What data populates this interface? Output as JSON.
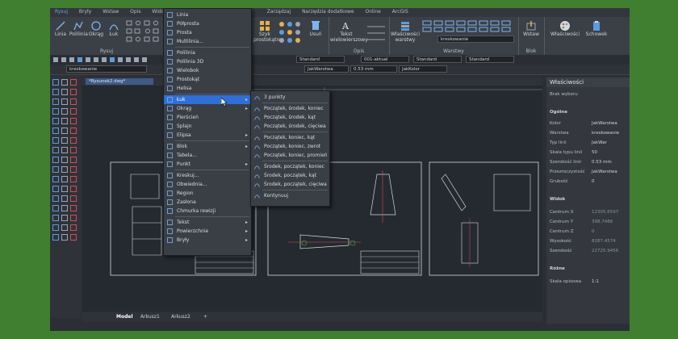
{
  "ribbon": {
    "tabs": [
      "Rysuj",
      "Bryły",
      "Wstaw",
      "Opis",
      "Widok",
      "Zarządzaj",
      "Narzędzia dodatkowe",
      "Online",
      "ArcGIS"
    ],
    "group_rysuj": "Rysuj",
    "group_opis": "Opis",
    "group_warstwy": "Warstwy",
    "group_blok": "Blok",
    "tools": {
      "linia": "Linia",
      "polilinia": "Polilinia",
      "okrag": "Okrąg",
      "luk": "Łuk",
      "szyk": "Szyk prostokątny",
      "usun": "Usuń",
      "tekst": "Tekst wielowierszowy",
      "wlasciwosci_warstwy": "Właściwości warstwy",
      "wstaw": "Wstaw",
      "wlasciwosci": "Właściwości",
      "schowek": "Schowek"
    },
    "layer_combo": "kreskowanie"
  },
  "toolbar": {
    "layer": "kreskowanie",
    "style1": "Standard",
    "style2": "001-aktual",
    "style3": "Standard",
    "style4": "Standard",
    "linetype": "JakWarstwa",
    "lineweight": "0.53 mm",
    "color": "JakKolor"
  },
  "document": {
    "tab_name": "*Rysunek2.dwg*"
  },
  "layout_tabs": [
    "Model",
    "Arkusz1",
    "Arkusz2"
  ],
  "menu_rysuj": {
    "items": [
      {
        "label": "Linia",
        "arrow": false
      },
      {
        "label": "Półprosta",
        "arrow": false
      },
      {
        "label": "Prosta",
        "arrow": false
      },
      {
        "label": "Multilinia...",
        "arrow": false
      },
      {
        "label": "Polilinia",
        "arrow": false
      },
      {
        "label": "Polilinia 3D",
        "arrow": false
      },
      {
        "label": "Wielobok",
        "arrow": false
      },
      {
        "label": "Prostokąt",
        "arrow": false
      },
      {
        "label": "Helisa",
        "arrow": false
      },
      {
        "label": "Łuk",
        "arrow": true
      },
      {
        "label": "Okrąg",
        "arrow": true
      },
      {
        "label": "Pierścień",
        "arrow": false
      },
      {
        "label": "Splajn",
        "arrow": false
      },
      {
        "label": "Elipsa",
        "arrow": true
      },
      {
        "label": "Blok",
        "arrow": true
      },
      {
        "label": "Tabela...",
        "arrow": false
      },
      {
        "label": "Punkt",
        "arrow": true
      },
      {
        "label": "Kreskuj...",
        "arrow": false
      },
      {
        "label": "Obwiednia...",
        "arrow": false
      },
      {
        "label": "Region",
        "arrow": false
      },
      {
        "label": "Zasłona",
        "arrow": false
      },
      {
        "label": "Chmurka rewizji",
        "arrow": false
      },
      {
        "label": "Tekst",
        "arrow": true
      },
      {
        "label": "Powierzchnie",
        "arrow": true
      },
      {
        "label": "Bryły",
        "arrow": true
      }
    ]
  },
  "menu_luk": {
    "items": [
      "3 punkty",
      "Początek, środek, koniec",
      "Początek, środek, kąt",
      "Początek, środek, cięciwa",
      "Początek, koniec, kąt",
      "Początek, koniec, zwrot",
      "Początek, koniec, promień",
      "Środek, początek, koniec",
      "Środek, początek, kąt",
      "Środek, początek, cięciwa",
      "Kontynuuj"
    ]
  },
  "properties": {
    "title": "Właściwości",
    "no_selection": "Brak wyboru",
    "sec_ogolne": "Ogólne",
    "sec_widok": "Widok",
    "sec_rozne": "Różne",
    "rows_ogolne": [
      {
        "k": "Kolor",
        "v": "JakWarstwa"
      },
      {
        "k": "Warstwa",
        "v": "kreskowanie"
      },
      {
        "k": "Typ linii",
        "v": "JakWar"
      },
      {
        "k": "Skala typu linii",
        "v": "50"
      },
      {
        "k": "Szerokość linii",
        "v": "0.53 mm"
      },
      {
        "k": "Przezroczystość",
        "v": "JakWarstwa"
      },
      {
        "k": "Grubość",
        "v": "0"
      }
    ],
    "rows_widok": [
      {
        "k": "Centrum X",
        "v": "12305.6597"
      },
      {
        "k": "Centrum Y",
        "v": "398.7486"
      },
      {
        "k": "Centrum Z",
        "v": "0"
      },
      {
        "k": "Wysokość",
        "v": "8287.4574"
      },
      {
        "k": "Szerokość",
        "v": "22725.9456"
      }
    ],
    "rows_rozne": [
      {
        "k": "Skala opisowa",
        "v": "1:1"
      }
    ]
  }
}
